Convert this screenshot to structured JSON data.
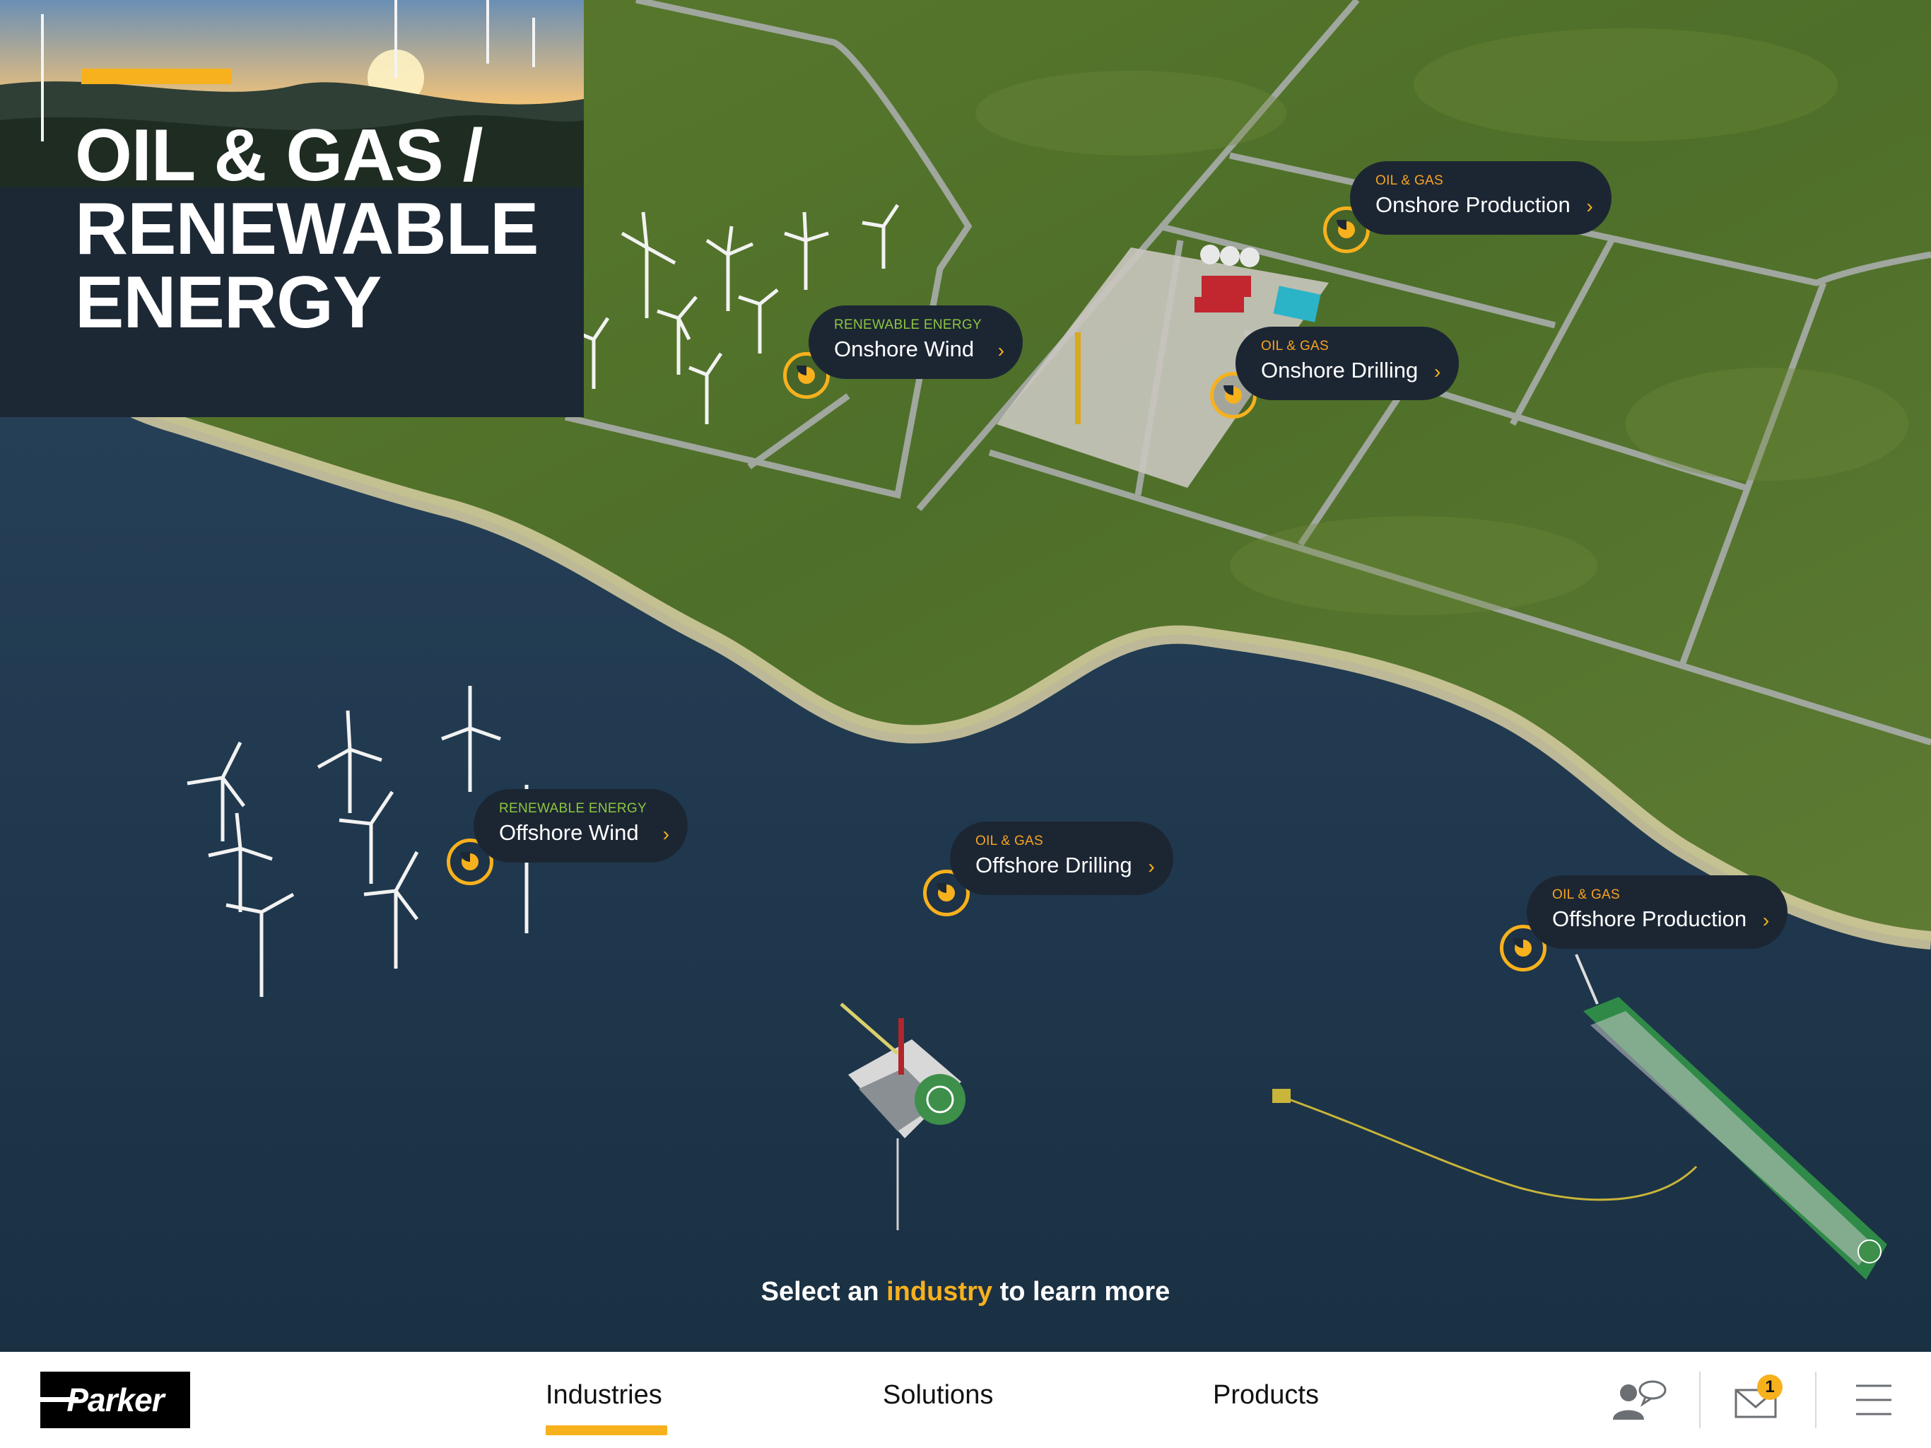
{
  "hero": {
    "title_lines": [
      "OIL & GAS /",
      "RENEWABLE",
      "ENERGY"
    ]
  },
  "hotspots": [
    {
      "category": "OIL & GAS",
      "name": "Onshore Production",
      "category_color": "#f7a321"
    },
    {
      "category": "RENEWABLE ENERGY",
      "name": "Onshore Wind",
      "category_color": "#8cc63f"
    },
    {
      "category": "OIL & GAS",
      "name": "Onshore Drilling",
      "category_color": "#f7a321"
    },
    {
      "category": "RENEWABLE ENERGY",
      "name": "Offshore Wind",
      "category_color": "#8cc63f"
    },
    {
      "category": "OIL & GAS",
      "name": "Offshore Drilling",
      "category_color": "#f7a321"
    },
    {
      "category": "OIL & GAS",
      "name": "Offshore Production",
      "category_color": "#f7a321"
    }
  ],
  "prompt": {
    "before": "Select an",
    "highlight": "industry",
    "after": "to learn more"
  },
  "nav": {
    "logo": "Parker",
    "items": [
      "Industries",
      "Solutions",
      "Products"
    ],
    "active": "Industries",
    "icons": [
      "contact-chat-icon",
      "mail-icon",
      "hamburger-menu-icon"
    ],
    "mail_badge": "1"
  },
  "colors": {
    "accent": "#f7b11d",
    "panel": "#1d2835",
    "callout_bg": "#1c2633"
  }
}
